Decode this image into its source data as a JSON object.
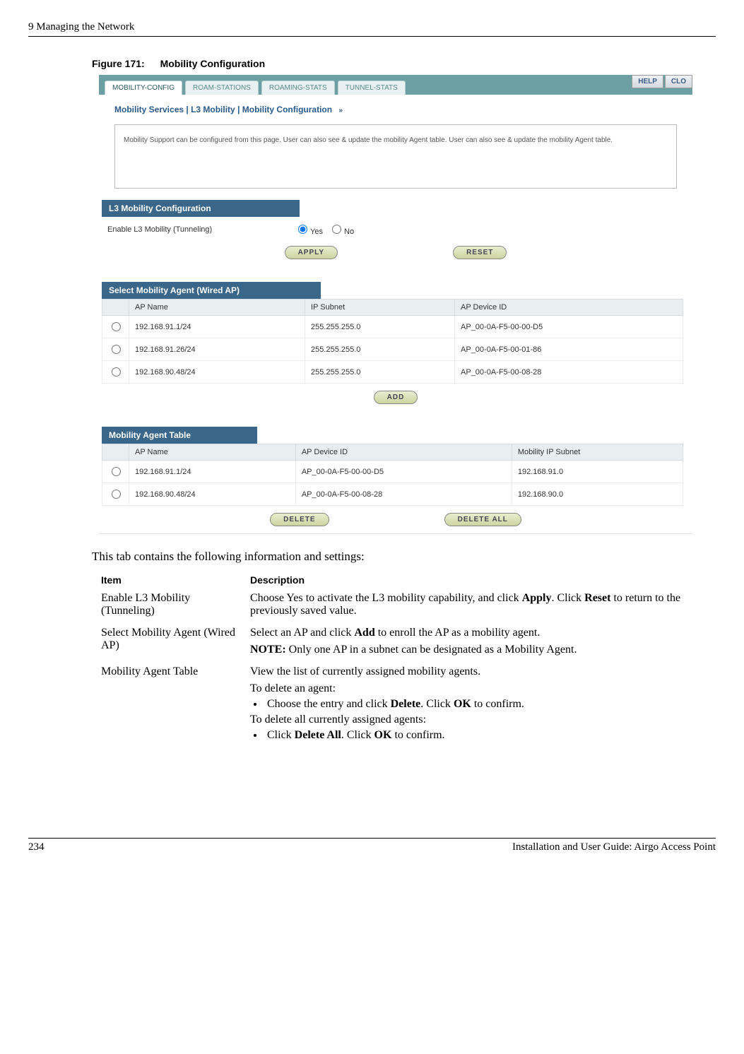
{
  "header": {
    "chapter": "9  Managing the Network"
  },
  "figure": {
    "number": "Figure 171:",
    "title": "Mobility Configuration"
  },
  "screenshot": {
    "tabs": [
      "MOBILITY-CONFIG",
      "ROAM-STATIONS",
      "ROAMING-STATS",
      "TUNNEL-STATS"
    ],
    "help_buttons": [
      "HELP",
      "CLO"
    ],
    "breadcrumb": "Mobility Services | L3 Mobility | Mobility Configuration",
    "description": "Mobility Support can be configured from this page. User can also see & update the mobility Agent table. User can also see & update the mobility Agent table.",
    "l3_config": {
      "title": "L3 Mobility Configuration",
      "label": "Enable L3 Mobility (Tunneling)",
      "options": {
        "yes": "Yes",
        "no": "No"
      },
      "apply": "APPLY",
      "reset": "RESET"
    },
    "select_agent": {
      "title": "Select Mobility Agent (Wired AP)",
      "headers": [
        "AP Name",
        "IP Subnet",
        "AP Device ID"
      ],
      "rows": [
        {
          "name": "192.168.91.1/24",
          "subnet": "255.255.255.0",
          "device": "AP_00-0A-F5-00-00-D5"
        },
        {
          "name": "192.168.91.26/24",
          "subnet": "255.255.255.0",
          "device": "AP_00-0A-F5-00-01-86"
        },
        {
          "name": "192.168.90.48/24",
          "subnet": "255.255.255.0",
          "device": "AP_00-0A-F5-00-08-28"
        }
      ],
      "add": "ADD"
    },
    "agent_table": {
      "title": "Mobility Agent Table",
      "headers": [
        "AP Name",
        "AP Device ID",
        "Mobility IP Subnet"
      ],
      "rows": [
        {
          "name": "192.168.91.1/24",
          "device": "AP_00-0A-F5-00-00-D5",
          "subnet": "192.168.91.0"
        },
        {
          "name": "192.168.90.48/24",
          "device": "AP_00-0A-F5-00-08-28",
          "subnet": "192.168.90.0"
        }
      ],
      "delete": "DELETE",
      "delete_all": "DELETE ALL"
    }
  },
  "body_text": "This tab contains the following information and settings:",
  "definitions": {
    "headers": {
      "item": "Item",
      "desc": "Description"
    },
    "rows": [
      {
        "item": "Enable L3 Mobility (Tunneling)",
        "desc_parts": {
          "p1": "Choose Yes to activate the L3 mobility capability, and click ",
          "b1": "Apply",
          "p2": ". Click ",
          "b2": "Reset",
          "p3": " to return to the previously saved value."
        }
      },
      {
        "item": "Select Mobility Agent (Wired AP)",
        "line1": {
          "p1": "Select an AP and click ",
          "b1": "Add",
          "p2": " to enroll the AP as a mobility agent."
        },
        "note": {
          "b": "NOTE:",
          "p": " Only one AP in a subnet can be designated as a Mobility Agent."
        }
      },
      {
        "item": "Mobility Agent Table",
        "line1": "View the list of currently assigned mobility agents.",
        "line2": "To delete an agent:",
        "bullet1": {
          "p1": "Choose the entry and click ",
          "b1": "Delete",
          "p2": ". Click ",
          "b2": "OK",
          "p3": " to confirm."
        },
        "line3": "To delete all currently assigned agents:",
        "bullet2": {
          "p1": "Click ",
          "b1": "Delete All",
          "p2": ". Click ",
          "b2": "OK",
          "p3": " to confirm."
        }
      }
    ]
  },
  "footer": {
    "page": "234",
    "title": "Installation and User Guide: Airgo Access Point"
  }
}
